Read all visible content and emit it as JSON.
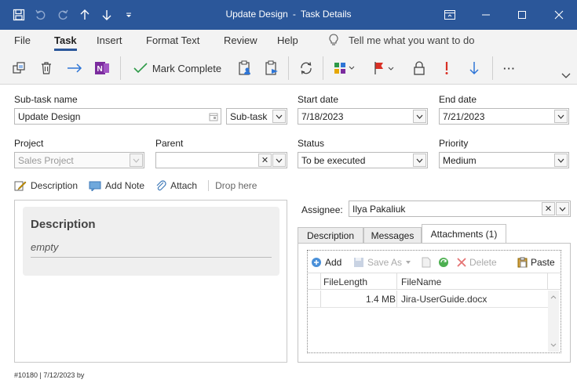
{
  "window": {
    "title_main": "Update Design",
    "title_separator": "-",
    "title_sub": "Task Details"
  },
  "menu": {
    "file": "File",
    "task": "Task",
    "insert": "Insert",
    "format_text": "Format Text",
    "review": "Review",
    "help": "Help",
    "tell_me": "Tell me what you want to do"
  },
  "ribbon": {
    "mark_complete": "Mark Complete",
    "more": "···"
  },
  "form": {
    "subtask_name_label": "Sub-task name",
    "subtask_name_value": "Update Design",
    "type_value": "Sub-task",
    "start_date_label": "Start date",
    "start_date_value": "7/18/2023",
    "end_date_label": "End date",
    "end_date_value": "7/21/2023",
    "project_label": "Project",
    "project_value": "Sales Project",
    "parent_label": "Parent",
    "parent_value": "",
    "status_label": "Status",
    "status_value": "To be executed",
    "priority_label": "Priority",
    "priority_value": "Medium",
    "assignee_label": "Assignee:",
    "assignee_value": "Ilya Pakaliuk"
  },
  "actions": {
    "description": "Description",
    "add_note": "Add Note",
    "attach": "Attach",
    "drop_here": "Drop here"
  },
  "description_card": {
    "heading": "Description",
    "value": "empty"
  },
  "tabs": {
    "description": "Description",
    "messages": "Messages",
    "attachments": "Attachments (1)"
  },
  "attachments": {
    "toolbar": {
      "add": "Add",
      "save_as": "Save As",
      "delete": "Delete",
      "paste": "Paste"
    },
    "columns": [
      "FileLength",
      "FileName"
    ],
    "rows": [
      {
        "file_length": "1.4 MB",
        "file_name": "Jira-UserGuide.docx"
      }
    ]
  },
  "footer": "#10180 | 7/12/2023 by",
  "colors": {
    "titlebar": "#2b579a",
    "accent_blue": "#2e75d6",
    "onenote_purple": "#7b2c9e",
    "check_green": "#2e9a48",
    "red": "#d93025"
  }
}
